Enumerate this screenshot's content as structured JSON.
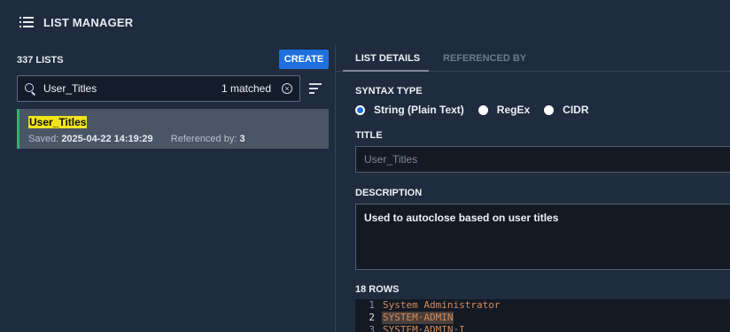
{
  "app": {
    "title": "LIST MANAGER"
  },
  "left": {
    "count_label": "337 LISTS",
    "create_label": "CREATE",
    "search": {
      "value": "User_Titles",
      "matched": "1 matched"
    },
    "items": [
      {
        "name": "User_Titles",
        "saved_label": "Saved:",
        "saved_value": "2025-04-22 14:19:29",
        "ref_label": "Referenced by:",
        "ref_value": "3"
      }
    ]
  },
  "right": {
    "tabs": [
      {
        "label": "LIST DETAILS"
      },
      {
        "label": "REFERENCED BY"
      }
    ],
    "syntax_type_label": "SYNTAX TYPE",
    "syntax_options": [
      {
        "label": "String (Plain Text)",
        "selected": true
      },
      {
        "label": "RegEx",
        "selected": false
      },
      {
        "label": "CIDR",
        "selected": false
      }
    ],
    "title_label": "TITLE",
    "title_value": "User_Titles",
    "description_label": "DESCRIPTION",
    "description_value": "Used to autoclose based on user titles",
    "rows_label": "18 ROWS",
    "rows": [
      {
        "n": "1",
        "text": "System Administrator"
      },
      {
        "n": "2",
        "text": "SYSTEM·ADMIN"
      },
      {
        "n": "3",
        "text": "SYSTEM·ADMIN·I"
      }
    ]
  },
  "colors": {
    "accent": "#1f6fde",
    "highlight": "#f1e51a",
    "success": "#2fb36b",
    "background": "#1f2b3e"
  },
  "icons": {
    "menu": "hamburger-list-icon",
    "search": "search-icon",
    "clear": "clear-circle-icon",
    "sort": "sort-icon"
  }
}
